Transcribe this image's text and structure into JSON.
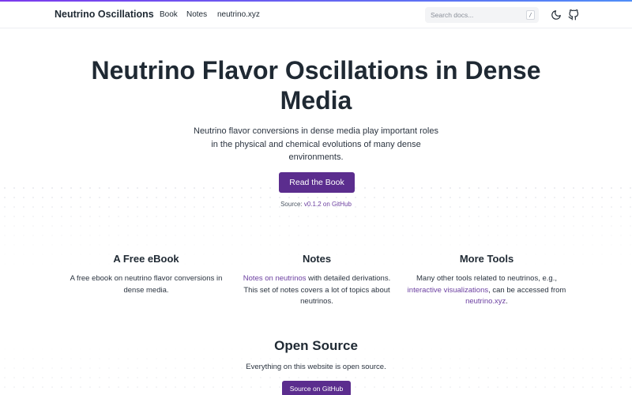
{
  "nav": {
    "brand": "Neutrino Oscillations",
    "links": [
      "Book",
      "Notes",
      "neutrino.xyz"
    ],
    "search_placeholder": "Search docs...",
    "search_shortcut": "/",
    "icons": [
      "moon-icon",
      "github-icon"
    ]
  },
  "hero": {
    "title": "Neutrino Flavor Oscillations in Dense Media",
    "description": "Neutrino flavor conversions in dense media play important roles in the physical and chemical evolutions of many dense environments.",
    "cta_label": "Read the Book",
    "source_prefix": "Source: ",
    "source_link": "v0.1.2 on GitHub"
  },
  "features": [
    {
      "title": "A Free eBook",
      "desc_plain": "A free ebook on neutrino flavor conversions in dense media."
    },
    {
      "title": "Notes",
      "desc_link": "Notes on neutrinos",
      "desc_rest": " with detailed derivations. This set of notes covers a lot of topics about neutrinos."
    },
    {
      "title": "More Tools",
      "desc_pre": "Many other tools related to neutrinos, e.g., ",
      "desc_link1": "interactive visualizations",
      "desc_mid": ", can be accessed from ",
      "desc_link2": "neutrino.xyz",
      "desc_end": "."
    }
  ],
  "open_source": {
    "title": "Open Source",
    "description": "Everything on this website is open source.",
    "button_label": "Source on GitHub"
  },
  "colors": {
    "primary": "#5b2d8e",
    "link": "#6b3fa0",
    "accent_gradient_start": "#7c3aed",
    "accent_gradient_end": "#4f8df7"
  }
}
